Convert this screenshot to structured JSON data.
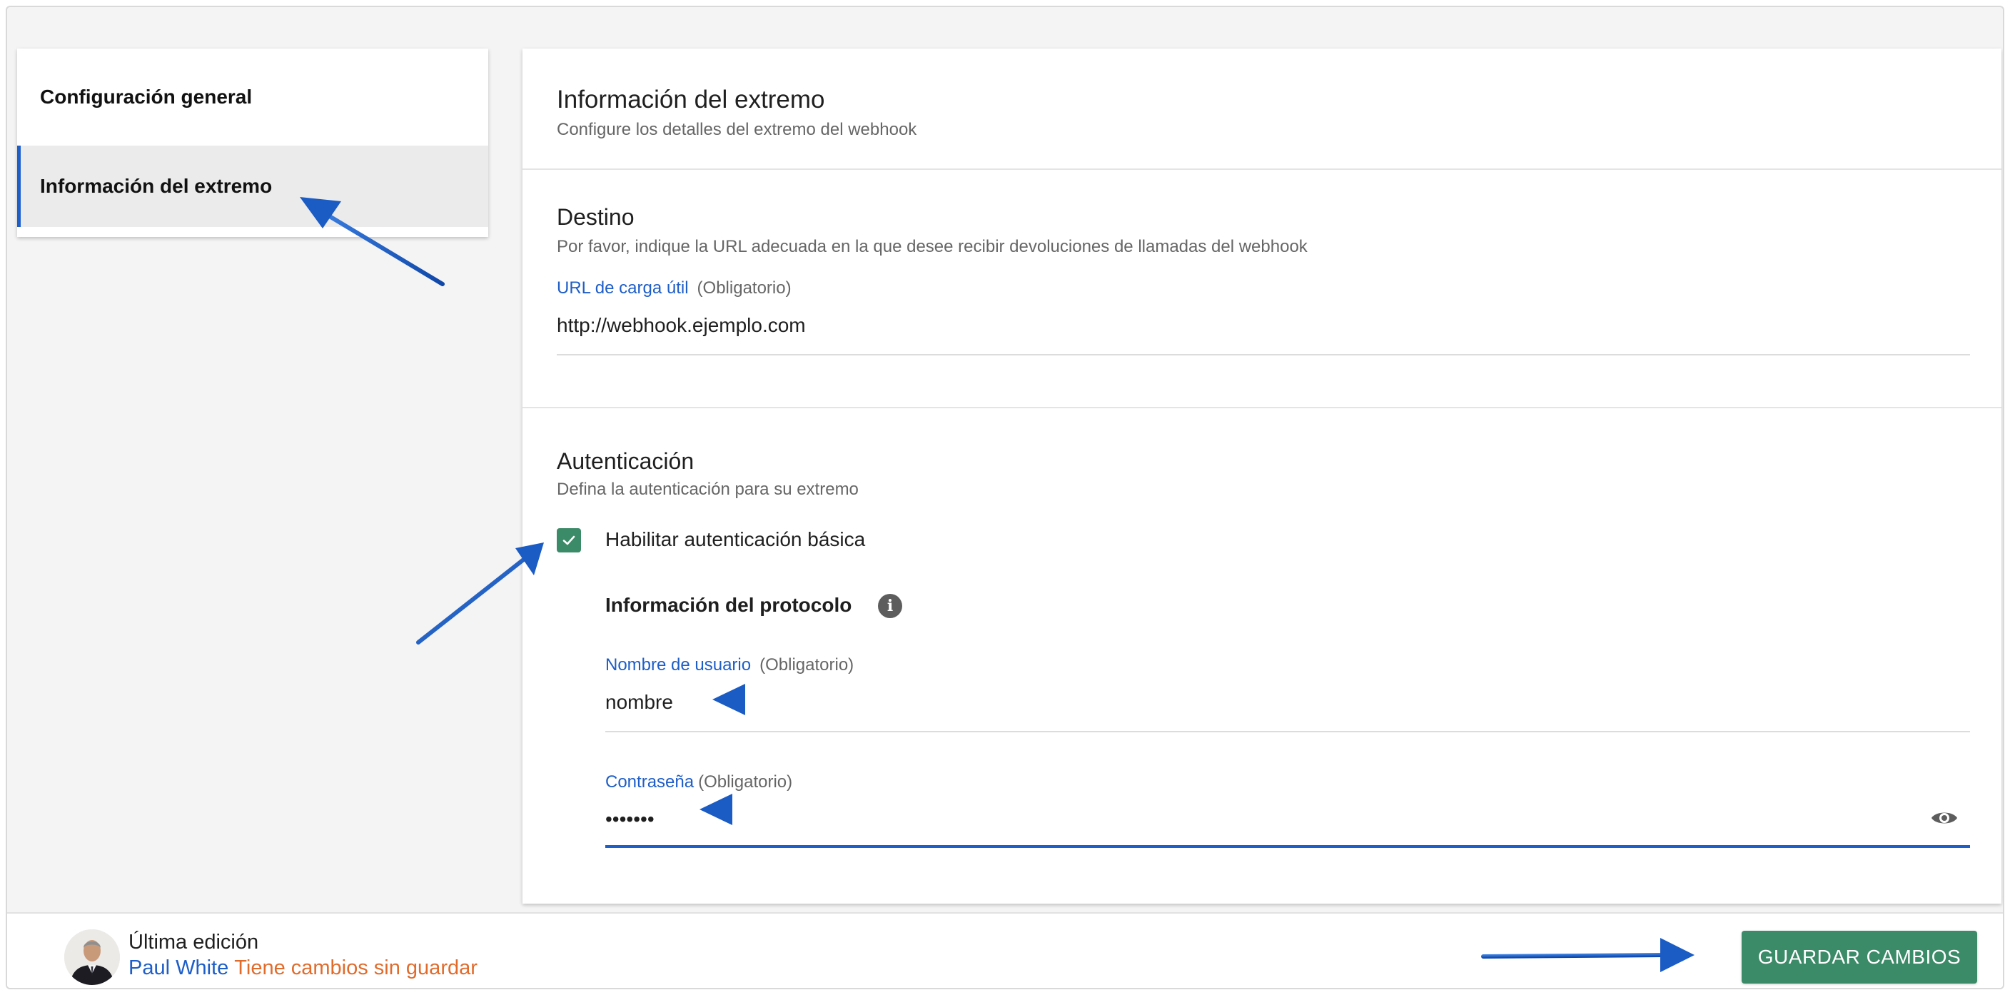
{
  "sidebar": {
    "items": [
      {
        "label": "Configuración general"
      },
      {
        "label": "Información del extremo"
      }
    ]
  },
  "header": {
    "title": "Información del extremo",
    "subtitle": "Configure los detalles del extremo del webhook"
  },
  "destination": {
    "title": "Destino",
    "subtitle": "Por favor, indique la URL adecuada en la que desee recibir devoluciones de llamadas del webhook",
    "url_label": "URL de carga útil",
    "url_required": "(Obligatorio)",
    "url_value": "http://webhook.ejemplo.com"
  },
  "auth": {
    "title": "Autenticación",
    "subtitle": "Defina la autenticación para su extremo",
    "basic_label": "Habilitar autenticación básica",
    "basic_checked": true,
    "protocol_title": "Información del protocolo",
    "username_label": "Nombre de usuario",
    "username_required": "(Obligatorio)",
    "username_value": "nombre",
    "password_label": "Contraseña",
    "password_required": "(Obligatorio)",
    "password_value": "•••••••"
  },
  "footer": {
    "last_edit_label": "Última edición",
    "user_name": "Paul White",
    "status_text": "Tiene cambios sin guardar",
    "save_label": "GUARDAR CAMBIOS"
  },
  "colors": {
    "accent_blue": "#1e5ec8",
    "primary_green": "#3b8a68",
    "warning_orange": "#e16b2b",
    "annotation_arrow": "#1a5bc4"
  },
  "icons": [
    "check-icon",
    "info-icon",
    "eye-icon",
    "user-avatar",
    "annotation-arrow"
  ]
}
